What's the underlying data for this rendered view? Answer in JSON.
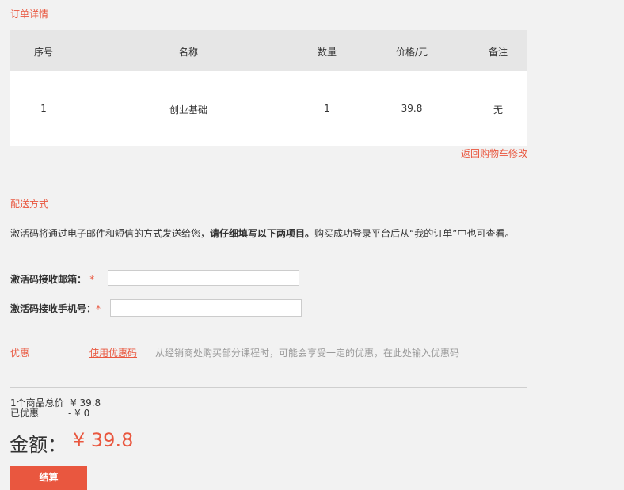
{
  "order": {
    "title": "订单详情",
    "columns": [
      "序号",
      "名称",
      "数量",
      "价格/元",
      "备注"
    ],
    "row": [
      "1",
      "创业基础",
      "1",
      "39.8",
      "无"
    ],
    "back_link": "返回购物车修改"
  },
  "delivery": {
    "title": "配送方式",
    "desc_pre": "激活码将通过电子邮件和短信的方式发送给您，",
    "desc_bold": "请仔细填写以下两项目。",
    "desc_post": "购买成功登录平台后从“我的订单”中也可查看。",
    "email_label": "激活码接收邮箱：",
    "phone_label": "激活码接收手机号：",
    "required_mark": "*",
    "email_value": "",
    "phone_value": ""
  },
  "coupon": {
    "title": "优惠",
    "link": "使用优惠码",
    "hint": "从经销商处购买部分课程时，可能会享受一定的优惠，在此处输入优惠码"
  },
  "summary": {
    "items_label": "1个商品总价",
    "items_value": "¥ 39.8",
    "discount_label": "已优惠",
    "discount_value": "- ¥ 0",
    "total_label": "金额：",
    "total_value": "¥ 39.8",
    "checkout_label": "结算"
  }
}
